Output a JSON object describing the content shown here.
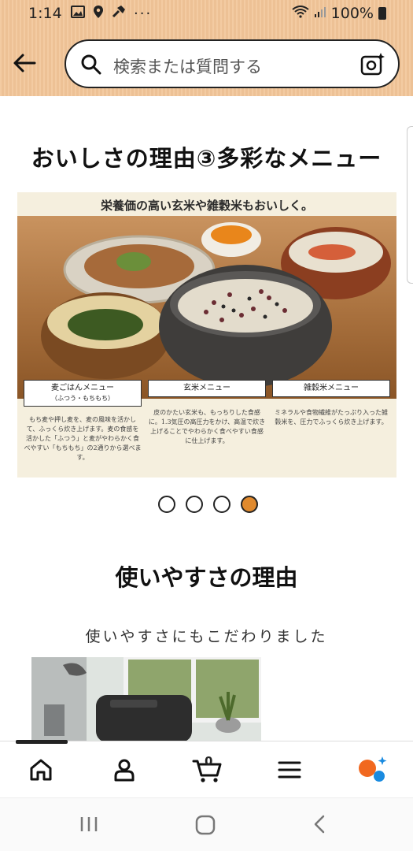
{
  "status_bar": {
    "time": "1:14",
    "battery": "100%",
    "icons": [
      "image-icon",
      "location-icon",
      "hammer-icon",
      "more-dots-icon"
    ]
  },
  "header": {
    "search_placeholder": "検索または質問する"
  },
  "section1": {
    "title": "おいしさの理由③多彩なメニュー",
    "banner_title": "栄養価の高い玄米や雑穀米もおいしく。",
    "labels": [
      {
        "title": "麦ごはんメニュー",
        "sub": "（ふつう・もちもち）"
      },
      {
        "title": "玄米メニュー"
      },
      {
        "title": "雑穀米メニュー"
      }
    ],
    "descriptions": [
      "もち麦や押し麦を、麦の風味を活かして、ふっくら炊き上げます。麦の食感を活かした「ふつう」と麦がやわらかく食べやすい「もちもち」の2通りから選べます。",
      "皮のかたい玄米も、もっちりした食感に。1.3気圧の高圧力をかけ、高温で炊き上げることでやわらかく食べやすい食感に仕上げます。",
      "ミネラルや食物繊維がたっぷり入った雑穀米を、圧力でふっくら炊き上げます。"
    ],
    "carousel": {
      "count": 4,
      "active_index": 3
    }
  },
  "section2": {
    "title": "使いやすさの理由",
    "subtitle": "使いやすさにもこだわりました"
  },
  "bottom_nav": {
    "cart_count": "0",
    "items": [
      "home-icon",
      "account-icon",
      "cart-icon",
      "menu-icon",
      "rufus-icon"
    ],
    "active_index": 0
  },
  "colors": {
    "header_bg": "#f2c598",
    "carousel_active": "#e08a2e",
    "banner_bg": "#f5efde"
  }
}
